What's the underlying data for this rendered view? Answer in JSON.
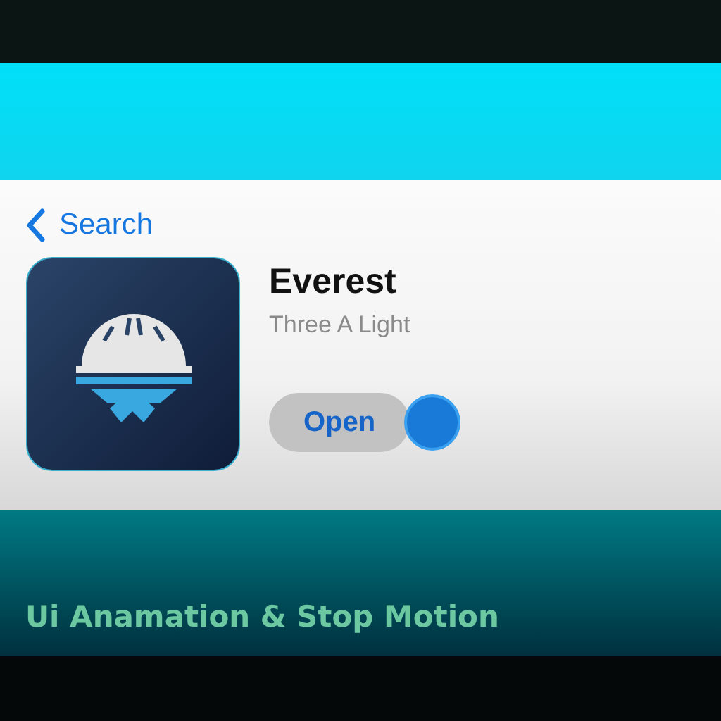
{
  "back_link": {
    "label": "Search"
  },
  "app": {
    "name": "Everest",
    "developer": "Three A Light",
    "action": {
      "label": "Open",
      "pressed": true
    }
  },
  "caption": "Ui Anamation & Stop Motion"
}
